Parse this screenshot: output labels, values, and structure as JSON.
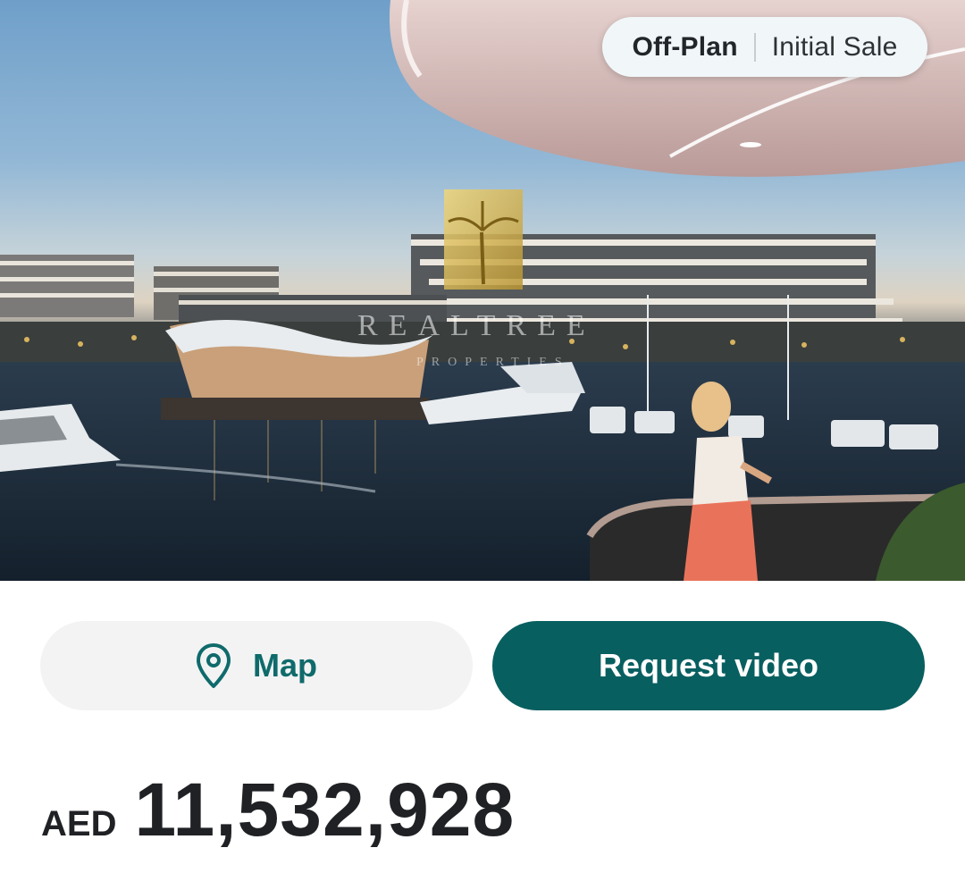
{
  "listing": {
    "badge": {
      "status": "Off-Plan",
      "sale_type": "Initial Sale"
    },
    "watermark": {
      "brand": "REALTREE",
      "sub": "PROPERTIES"
    }
  },
  "actions": {
    "map_label": "Map",
    "video_label": "Request video"
  },
  "price": {
    "currency": "AED",
    "amount": "11,532,928"
  },
  "colors": {
    "primary": "#085f60",
    "primary_text": "#0f6a6b",
    "secondary_bg": "#f3f3f4"
  }
}
